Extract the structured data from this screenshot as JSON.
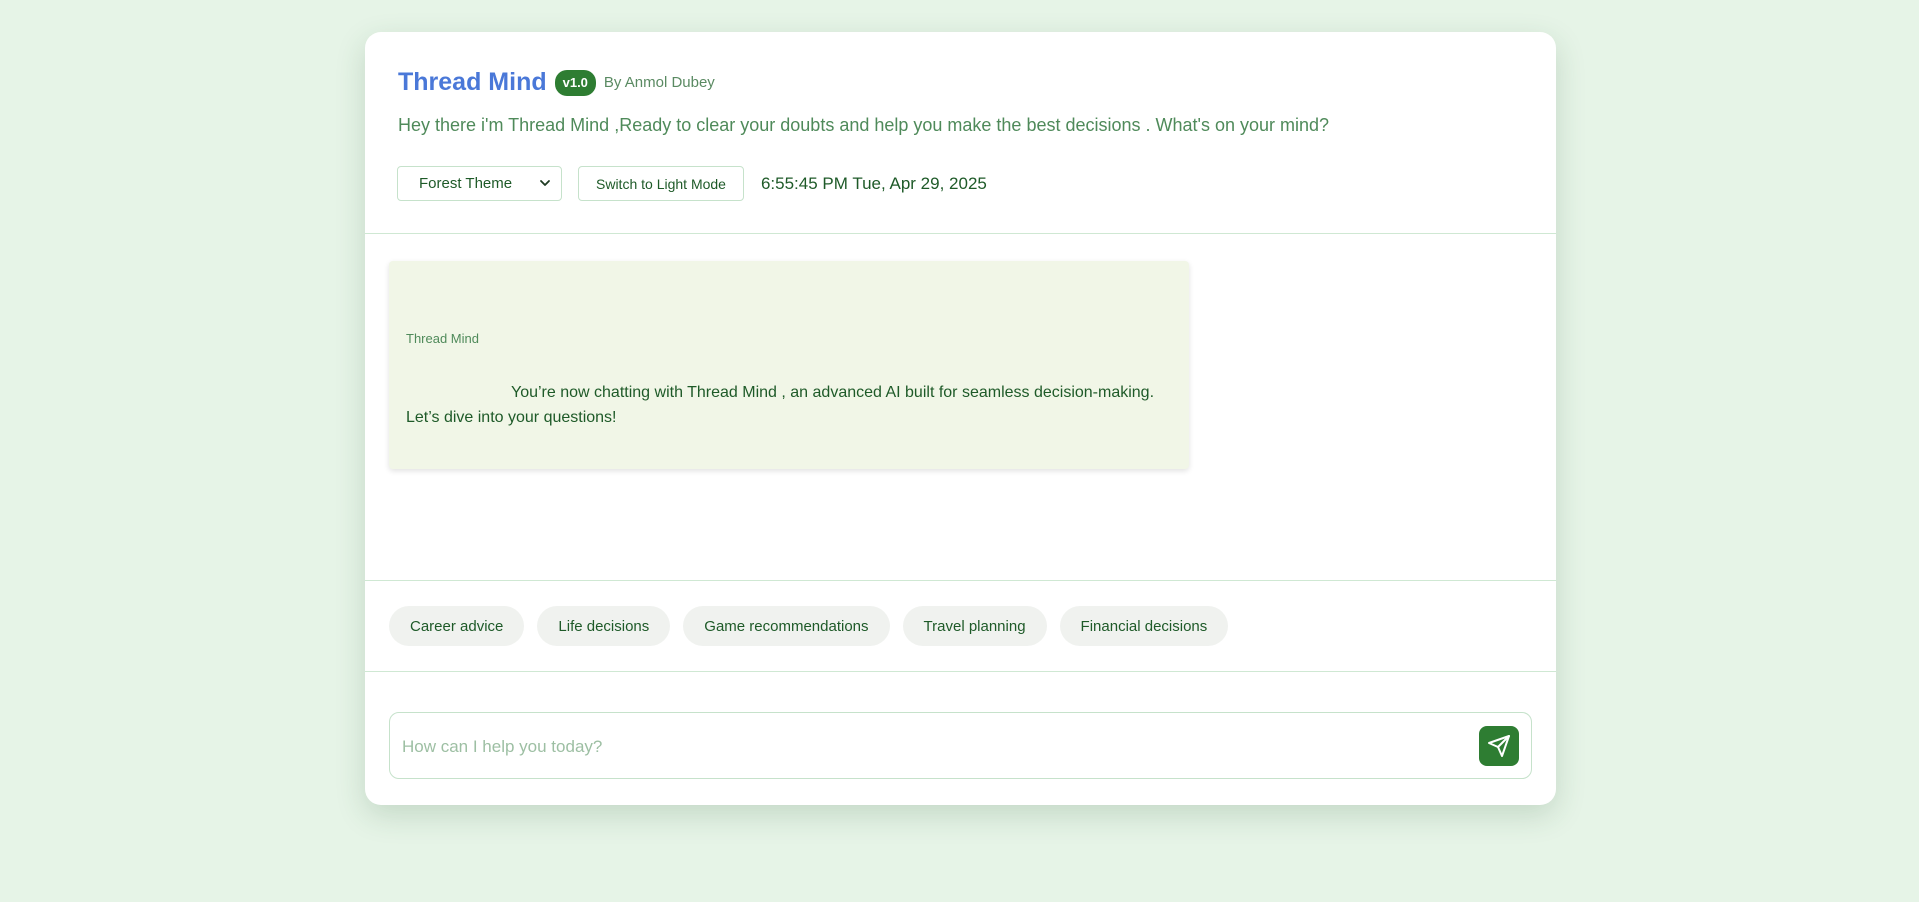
{
  "header": {
    "title": "Thread Mind",
    "version": "v1.0",
    "author": "By Anmol Dubey",
    "tagline": "Hey there i'm Thread Mind ,Ready to clear your doubts and help you make the best decisions . What's on your mind?",
    "theme_select_value": "Forest Theme",
    "mode_button_label": "Switch to Light Mode",
    "clock": "6:55:45 PM Tue, Apr 29, 2025"
  },
  "chat": {
    "messages": [
      {
        "sender": "Thread Mind",
        "text": "You’re now chatting with Thread Mind , an advanced AI built for seamless decision-making. Let’s dive into your questions!"
      }
    ]
  },
  "suggestions": [
    "Career advice",
    "Life decisions",
    "Game recommendations",
    "Travel planning",
    "Financial decisions"
  ],
  "input": {
    "placeholder": "How can I help you today?",
    "value": ""
  },
  "icons": {
    "send": "send-icon",
    "dropdown": "chevron-down-icon"
  },
  "colors": {
    "accent": "#2e7d32",
    "title": "#4a78d8",
    "page_bg": "#e6f4e7",
    "message_bg": "#f1f6e7"
  }
}
